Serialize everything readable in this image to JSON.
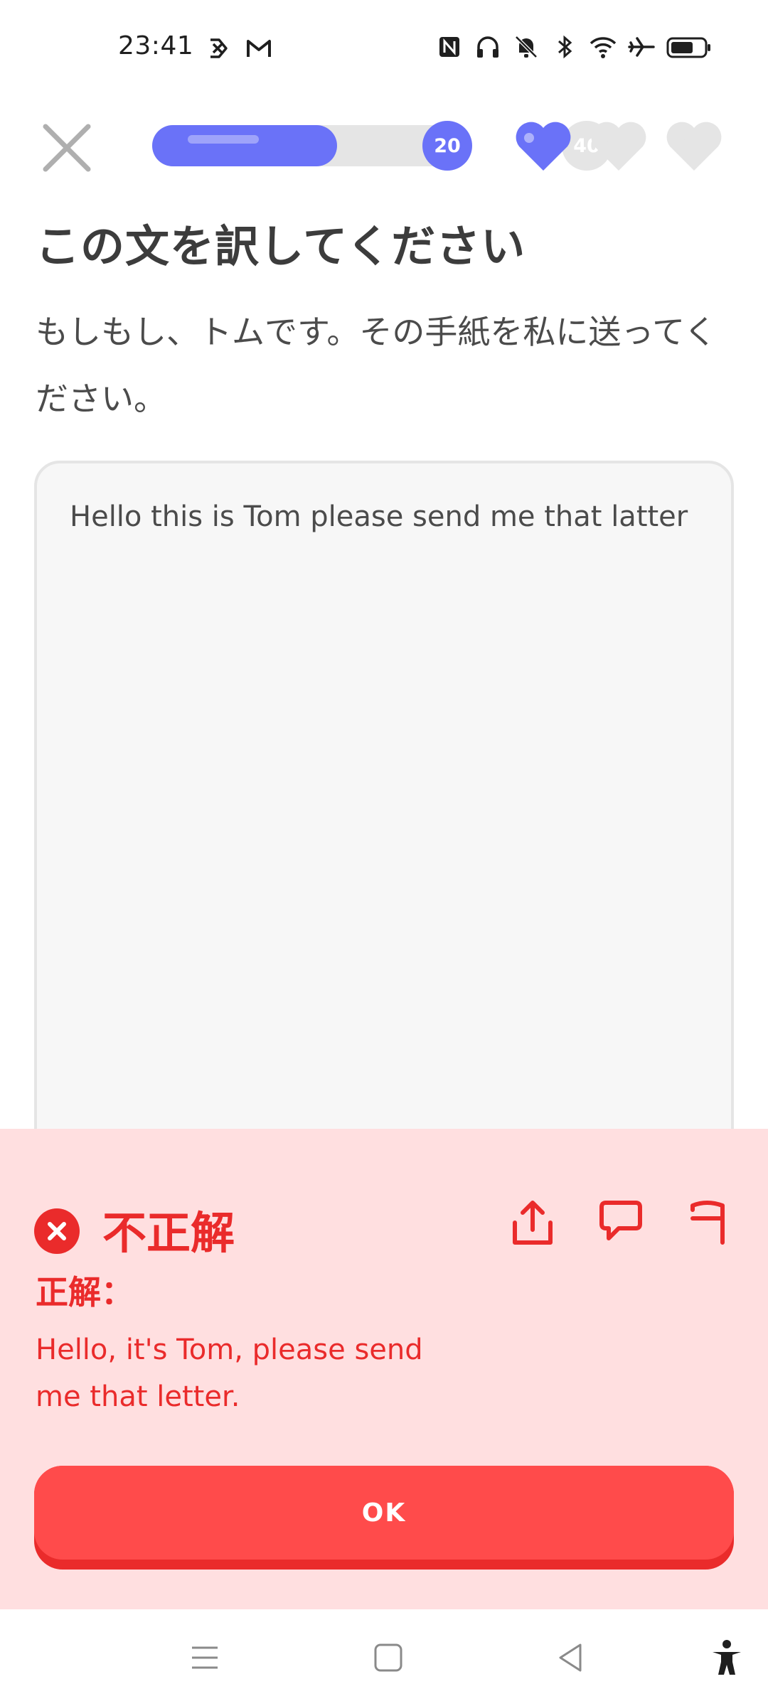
{
  "status_bar": {
    "time": "23:41"
  },
  "lesson": {
    "progress_fraction": 0.6,
    "progress_current": "20",
    "progress_next": "40",
    "hearts_filled": 1,
    "hearts_total": 3
  },
  "prompt": {
    "title": "この文を訳してください",
    "source_sentence": "もしもし、トムです。その手紙を私に送ってください。"
  },
  "answer": {
    "user_text": "Hello this is Tom please send me that latter"
  },
  "feedback": {
    "status": "不正解",
    "label": "正解：",
    "correct_answer": "Hello, it's Tom, please send me that letter.",
    "ok_label": "OK"
  },
  "colors": {
    "accent": "#6a72f8",
    "error": "#ea2b2b",
    "error_bg": "#ffdfe0",
    "button": "#ff4b4b"
  }
}
